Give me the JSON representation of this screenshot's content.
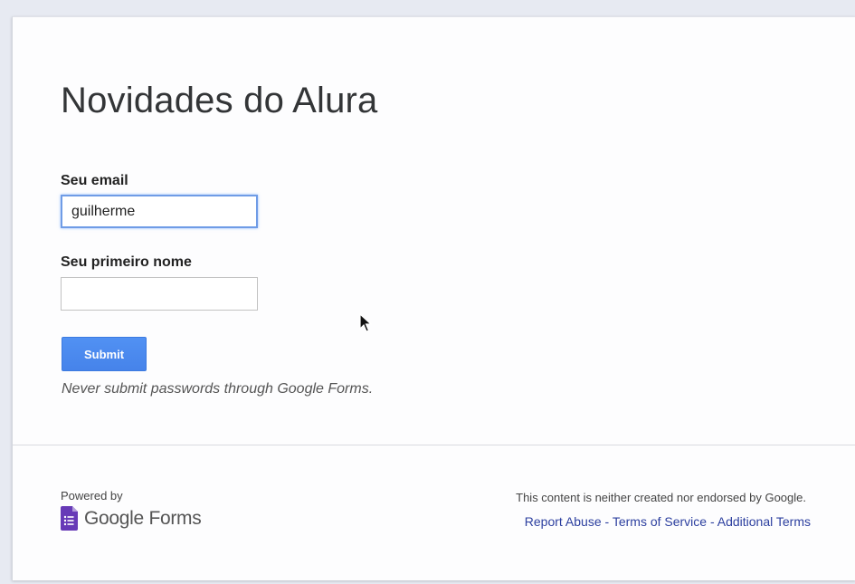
{
  "form": {
    "title": "Novidades do Alura",
    "fields": [
      {
        "label": "Seu email",
        "value": "guilherme",
        "placeholder": ""
      },
      {
        "label": "Seu primeiro nome",
        "value": "",
        "placeholder": ""
      }
    ],
    "submit_label": "Submit",
    "disclaimer": "Never submit passwords through Google Forms."
  },
  "footer": {
    "powered_by": "Powered by",
    "brand": "Google Forms",
    "note": "This content is neither created nor endorsed by Google.",
    "links": [
      "Report Abuse",
      "Terms of Service",
      "Additional Terms"
    ],
    "link_separator": " - "
  },
  "colors": {
    "accent": "#4285f4",
    "link": "#2c3f9f",
    "forms_icon": "#673ab7"
  },
  "icons": {
    "brand_icon": "google-forms-icon",
    "pointer": "mouse-cursor-icon"
  }
}
